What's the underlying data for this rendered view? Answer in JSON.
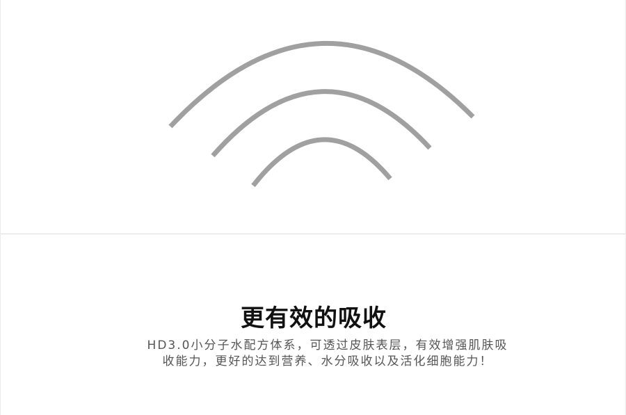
{
  "graphic": {
    "icon": "signal-waves-icon",
    "stroke_color": "#a0a0a0"
  },
  "content": {
    "title": "更有效的吸收",
    "description_line_1": "HD3.0小分子水配方体系，可透过皮肤表层，有效增强肌肤吸",
    "description_line_2": "收能力，更好的达到营养、水分吸收以及活化细胞能力！"
  }
}
